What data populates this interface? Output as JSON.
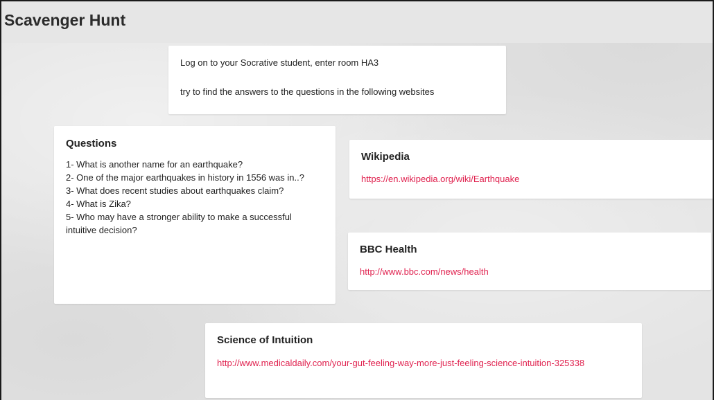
{
  "page": {
    "title": "Scavenger Hunt"
  },
  "intro": {
    "line1": "Log on to your Socrative student, enter room HA3",
    "line2": "try to find the answers to the questions in the following websites"
  },
  "questions": {
    "heading": "Questions",
    "items": [
      "1- What is another name for an earthquake?",
      "2- One of the major earthquakes in history in 1556 was in..?",
      "3- What does recent studies about earthquakes claim?",
      "4- What is Zika?",
      "5- Who may have a stronger ability to make a successful intuitive decision?"
    ]
  },
  "links": [
    {
      "heading": "Wikipedia",
      "url": "https://en.wikipedia.org/wiki/Earthquake"
    },
    {
      "heading": "BBC Health",
      "url": "http://www.bbc.com/news/health"
    },
    {
      "heading": "Science of Intuition",
      "url": "http://www.medicaldaily.com/your-gut-feeling-way-more-just-feeling-science-intuition-325338"
    }
  ],
  "colors": {
    "link": "#e0224f",
    "background": "#e4e4e4",
    "card": "#ffffff"
  }
}
